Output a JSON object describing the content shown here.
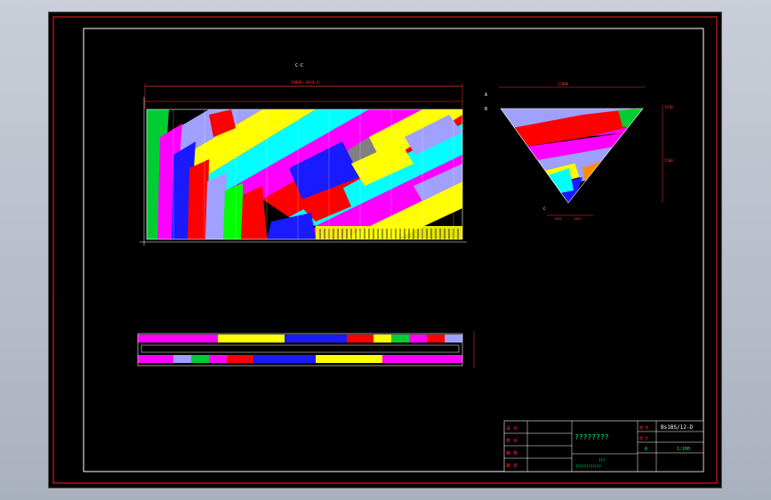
{
  "drawing": {
    "section_label": "C-C",
    "dim_main_width": "10000(.49+0.6)",
    "dim_side_width": "12000",
    "dim_side_right": "1930",
    "dim_side_height": "5500",
    "dim_side_bottom_left": "1000",
    "dim_side_bottom_right": "1000",
    "side_marker_top": "A",
    "side_marker_mid": "B",
    "side_marker_low": "C"
  },
  "title_block": {
    "drawing_number": "Bs1BS/12-D",
    "project_name": "????????",
    "sub_title": "???",
    "sub_caption": "????????????",
    "stage": "A",
    "scale": "1:100",
    "row_labels": [
      "设 计",
      "校 对",
      "审 核",
      "审 定"
    ],
    "status_cells": [
      "图 别",
      "图 号"
    ]
  },
  "colors": {
    "sheet_bg": "#000000",
    "border_red": "#ff2020",
    "frame_white": "#ffffff",
    "dim_red": "#ff3030",
    "dim_green": "#00ff66"
  }
}
